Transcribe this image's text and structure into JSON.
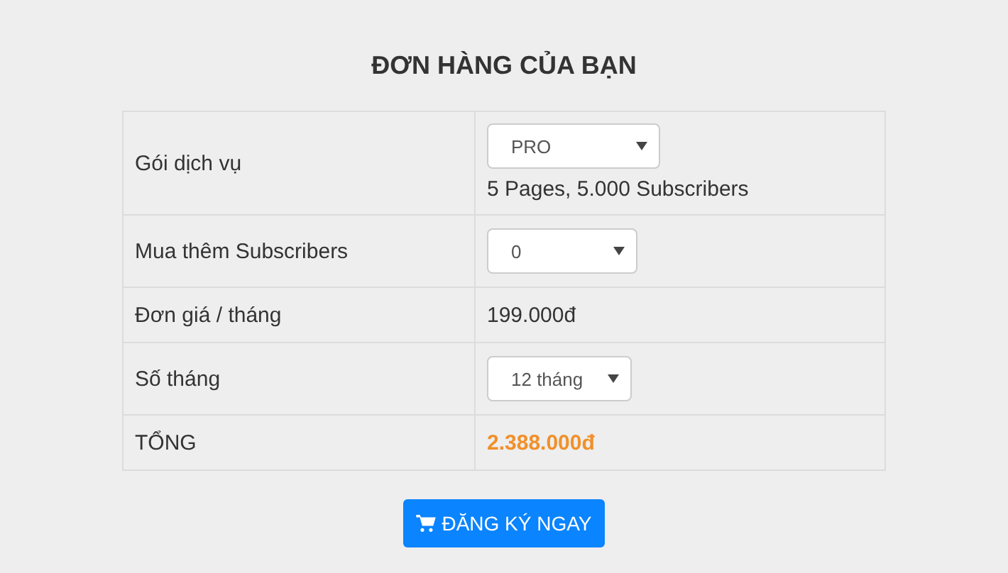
{
  "title": "ĐƠN HÀNG CỦA BẠN",
  "rows": [
    {
      "label": "Gói dịch vụ",
      "kind": "select",
      "value": "PRO",
      "note": "5 Pages, 5.000 Subscribers"
    },
    {
      "label": "Mua thêm Subscribers",
      "kind": "select",
      "value": "0"
    },
    {
      "label": "Đơn giá / tháng",
      "kind": "text",
      "value": "199.000đ"
    },
    {
      "label": "Số tháng",
      "kind": "select",
      "value": "12 tháng"
    },
    {
      "label": "TỔNG",
      "kind": "total",
      "value": "2.388.000đ"
    }
  ],
  "button": {
    "label": "ĐĂNG KÝ NGAY"
  }
}
